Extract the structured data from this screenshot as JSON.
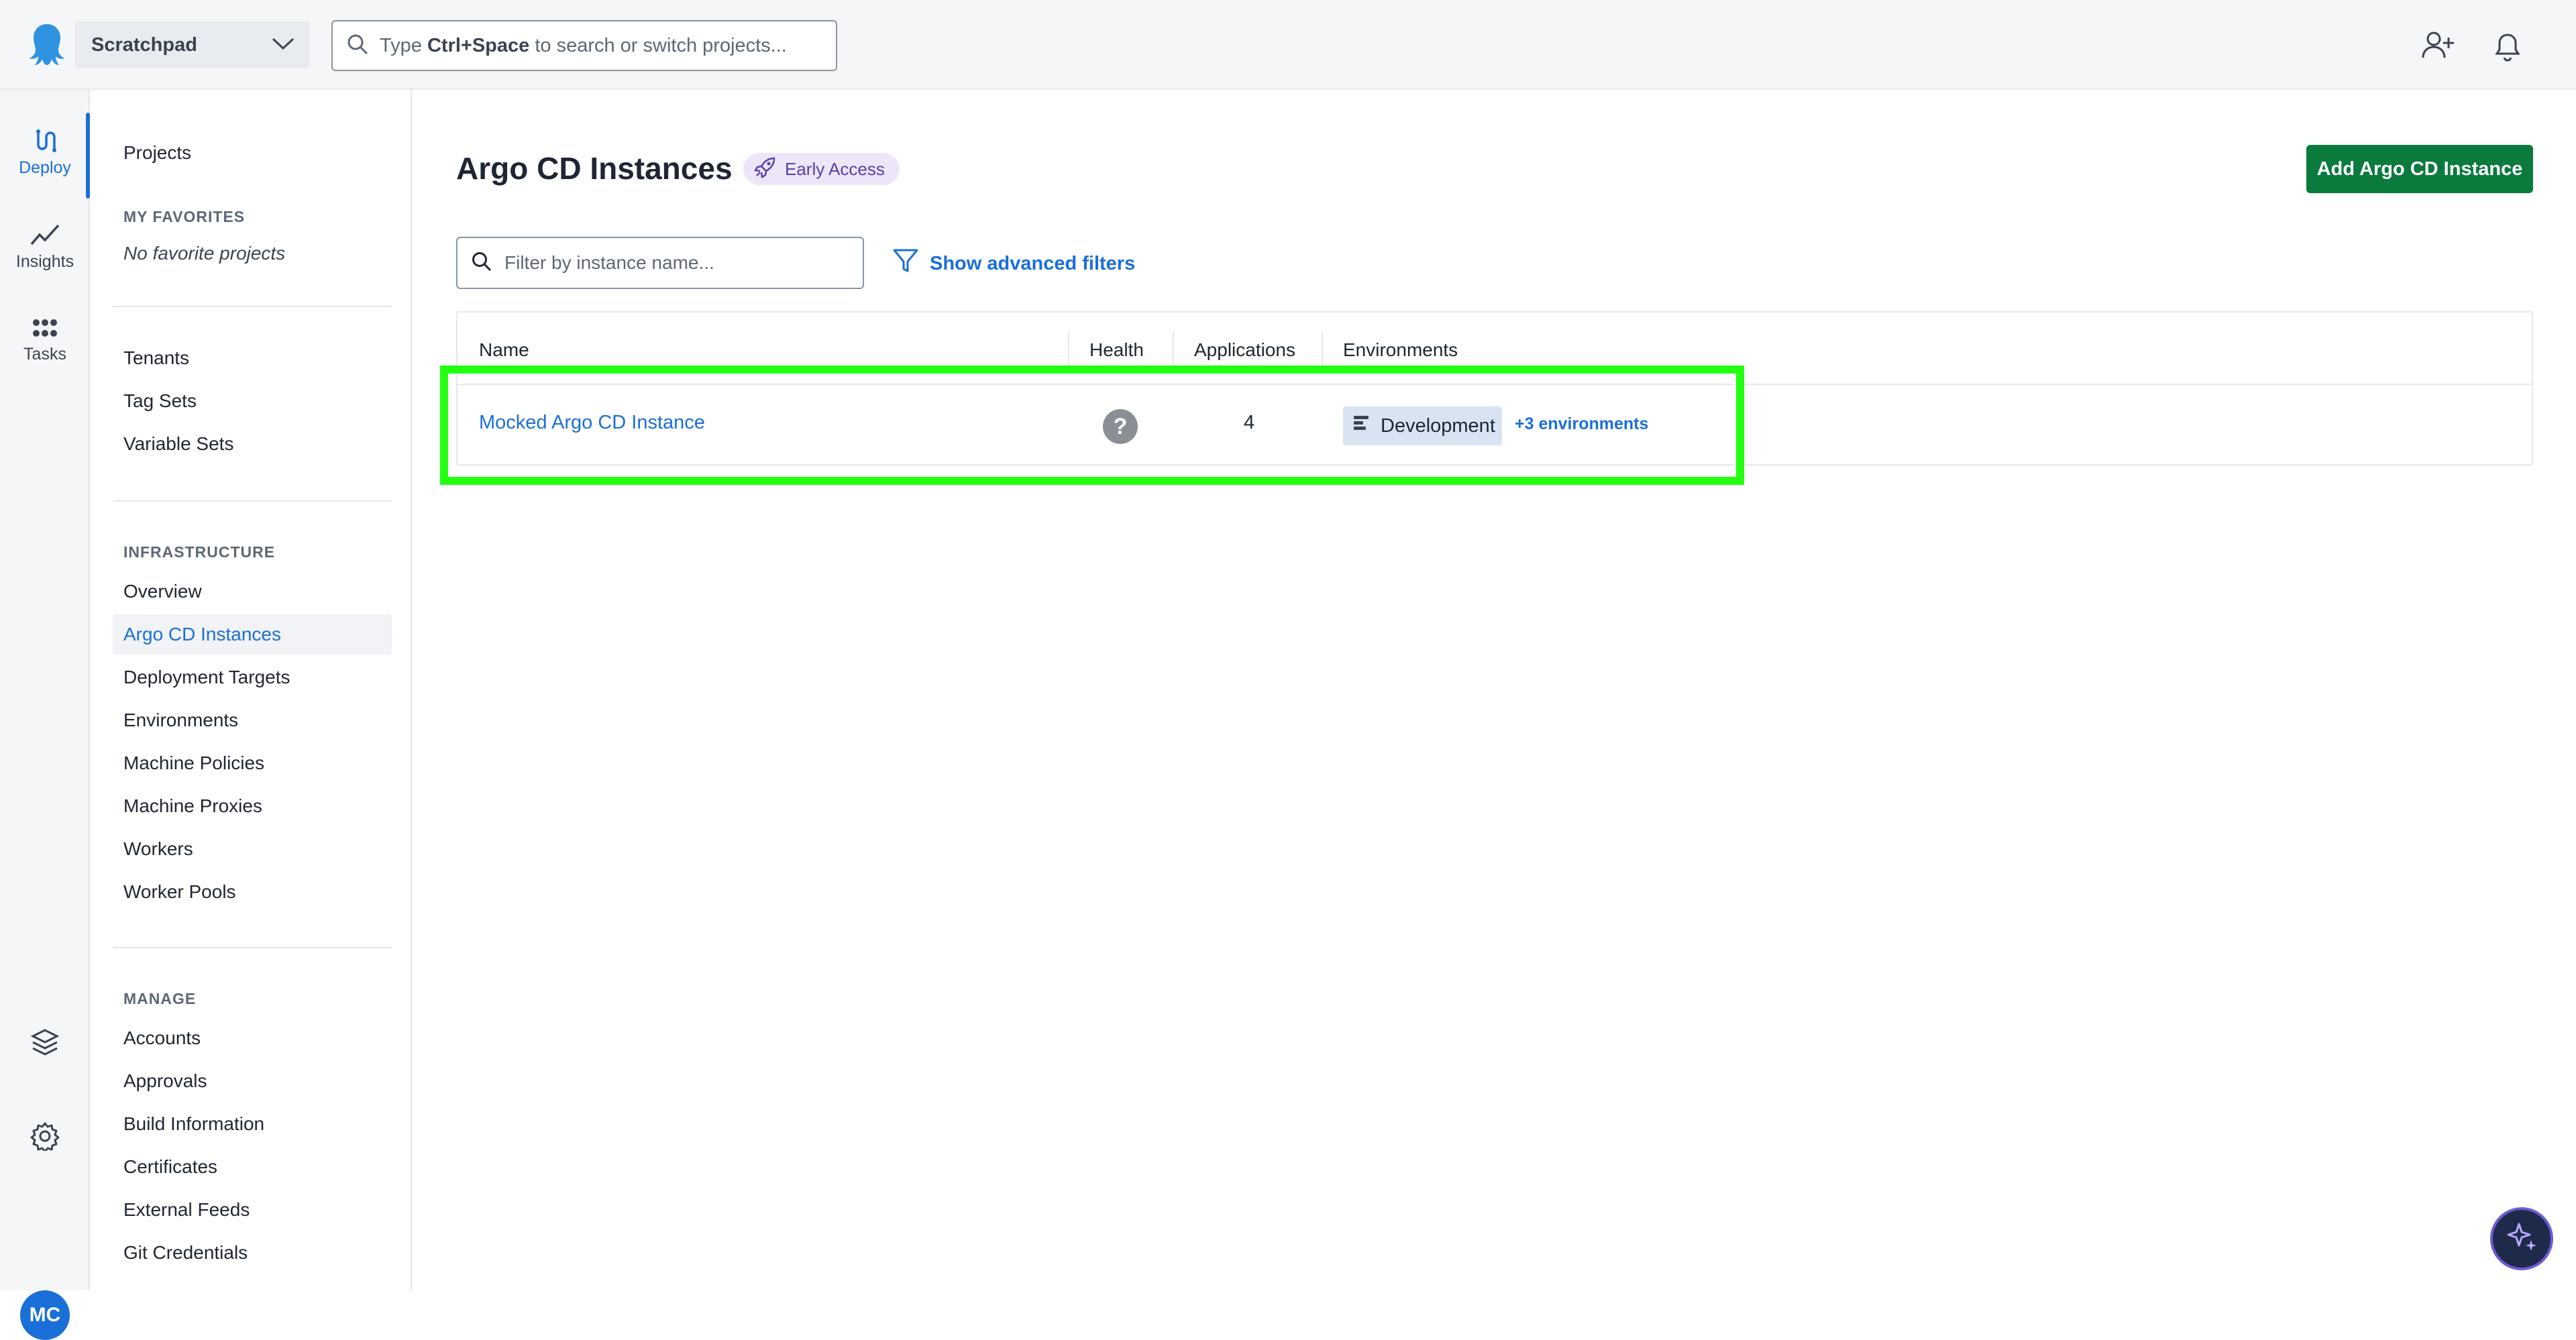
{
  "header": {
    "project_switcher": "Scratchpad",
    "search": {
      "prefix": "Type ",
      "shortcut": "Ctrl+Space",
      "suffix": " to search or switch projects..."
    }
  },
  "rail": {
    "items": [
      {
        "label": "Deploy",
        "icon": "deploy-icon"
      },
      {
        "label": "Insights",
        "icon": "insights-icon"
      },
      {
        "label": "Tasks",
        "icon": "tasks-icon"
      }
    ],
    "avatar_initials": "MC"
  },
  "sidebar": {
    "projects": "Projects",
    "favorites_heading": "MY FAVORITES",
    "favorites_empty": "No favorite projects",
    "general": [
      "Tenants",
      "Tag Sets",
      "Variable Sets"
    ],
    "infrastructure_heading": "INFRASTRUCTURE",
    "infrastructure": [
      "Overview",
      "Argo CD Instances",
      "Deployment Targets",
      "Environments",
      "Machine Policies",
      "Machine Proxies",
      "Workers",
      "Worker Pools"
    ],
    "manage_heading": "MANAGE",
    "manage": [
      "Accounts",
      "Approvals",
      "Build Information",
      "Certificates",
      "External Feeds",
      "Git Credentials"
    ]
  },
  "main": {
    "title": "Argo CD Instances",
    "badge": "Early Access",
    "add_button": "Add Argo CD Instance",
    "filter_placeholder": "Filter by instance name...",
    "advanced_filters": "Show advanced filters",
    "table": {
      "headers": [
        "Name",
        "Health",
        "Applications",
        "Environments"
      ],
      "rows": [
        {
          "name": "Mocked Argo CD Instance",
          "health": "?",
          "applications": "4",
          "environment": "Development",
          "more_environments": "+3 environments"
        }
      ]
    }
  },
  "colors": {
    "accent": "#1a6fd8",
    "primary_button": "#0b7a3d",
    "highlight": "#22ff11"
  }
}
